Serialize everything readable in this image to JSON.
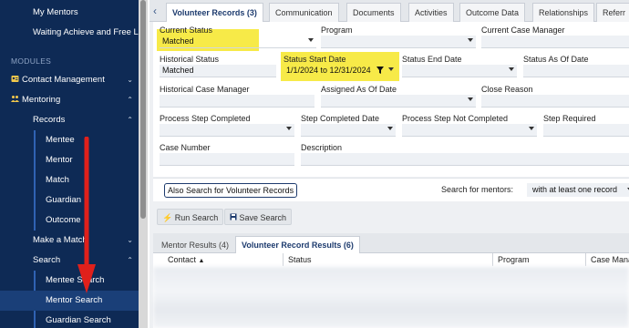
{
  "sidebar": {
    "top_items": [
      {
        "label": "My Mentors"
      },
      {
        "label": "Waiting Achieve and Free Lu..."
      }
    ],
    "modules_heading": "MODULES",
    "contact_management": "Contact Management",
    "mentoring": "Mentoring",
    "records": "Records",
    "record_items": [
      "Mentee",
      "Mentor",
      "Match",
      "Guardian",
      "Outcome"
    ],
    "make_a_match": "Make a Match",
    "search": "Search",
    "search_items": [
      "Mentee Search",
      "Mentor Search",
      "Guardian Search"
    ],
    "active_item": "Mentor Search"
  },
  "tabs": [
    "Volunteer Records (3)",
    "Communication",
    "Documents",
    "Activities",
    "Outcome Data",
    "Relationships",
    "Referr"
  ],
  "form": {
    "current_status": {
      "label": "Current Status",
      "value": "Matched"
    },
    "program": {
      "label": "Program",
      "value": ""
    },
    "current_case_manager": {
      "label": "Current Case Manager",
      "value": ""
    },
    "historical_status": {
      "label": "Historical Status",
      "value": "Matched"
    },
    "status_start_date": {
      "label": "Status Start Date",
      "value": "1/1/2024 to 12/31/2024"
    },
    "status_end_date": {
      "label": "Status End Date",
      "value": ""
    },
    "status_as_of_date": {
      "label": "Status As Of Date",
      "value": ""
    },
    "historical_case_manager": {
      "label": "Historical Case Manager",
      "value": ""
    },
    "assigned_as_of_date": {
      "label": "Assigned As Of Date",
      "value": ""
    },
    "close_reason": {
      "label": "Close Reason",
      "value": ""
    },
    "process_step_completed": {
      "label": "Process Step Completed",
      "value": ""
    },
    "step_completed_date": {
      "label": "Step Completed Date",
      "value": ""
    },
    "process_step_not_completed": {
      "label": "Process Step Not Completed",
      "value": ""
    },
    "step_required": {
      "label": "Step Required",
      "value": ""
    },
    "case_number": {
      "label": "Case Number",
      "value": ""
    },
    "description": {
      "label": "Description",
      "value": ""
    }
  },
  "also_search_label": "Also Search for Volunteer Records",
  "search_for_mentors_label": "Search for mentors:",
  "search_for_mentors_value": "with at least one record",
  "actions": {
    "run_search": "Run Search",
    "save_search": "Save Search"
  },
  "results": {
    "tabs": [
      "Mentor Results (4)",
      "Volunteer Record Results (6)"
    ],
    "columns": [
      "Contact",
      "Status",
      "Program",
      "Case Manag"
    ]
  },
  "colors": {
    "sidebar_bg": "#0e2a55",
    "highlight": "#f7ea48",
    "annotation_arrow": "#e0201b",
    "accent": "#1d3b6e"
  }
}
